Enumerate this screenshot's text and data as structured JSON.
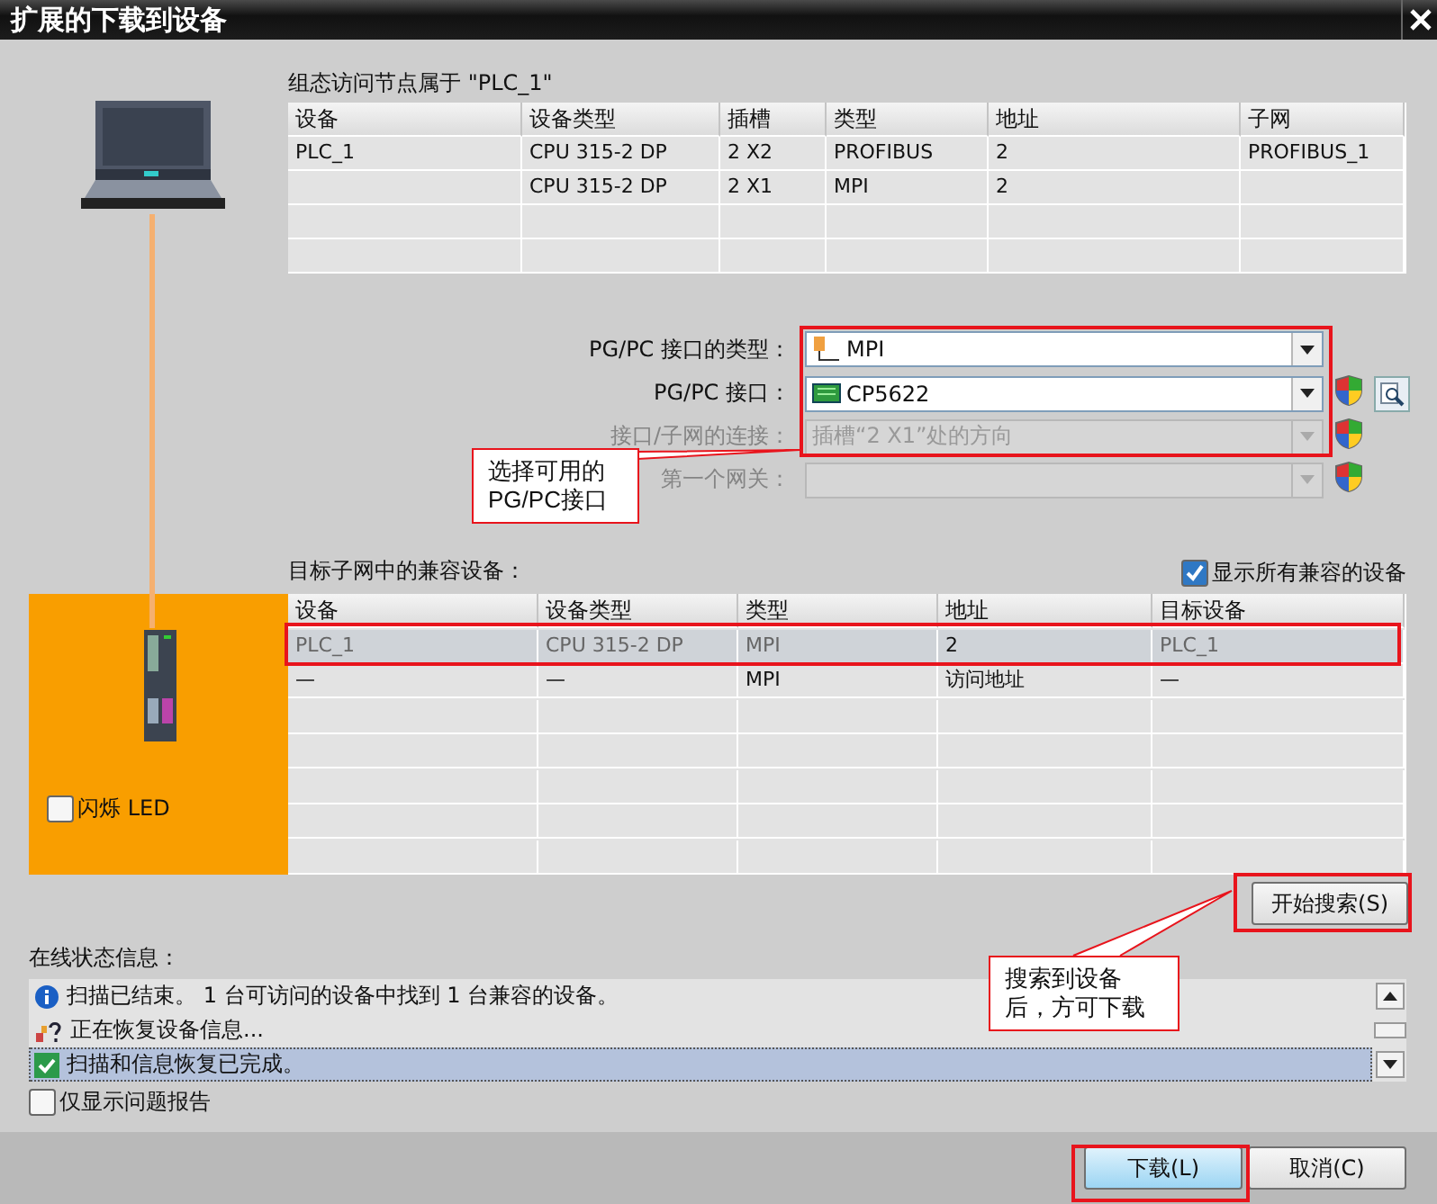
{
  "window": {
    "title": "扩展的下载到设备"
  },
  "configured_nodes": {
    "caption": "组态访问节点属于 \"PLC_1\"",
    "columns": [
      "设备",
      "设备类型",
      "插槽",
      "类型",
      "地址",
      "子网"
    ],
    "rows": [
      [
        "PLC_1",
        "CPU 315-2 DP",
        "2 X2",
        "PROFIBUS",
        "2",
        "PROFIBUS_1"
      ],
      [
        null,
        "CPU 315-2 DP",
        "2 X1",
        "MPI",
        "2",
        null
      ]
    ]
  },
  "interface_fields": [
    {
      "label": "PG/PC 接口的类型：",
      "value": "MPI",
      "kind": "network",
      "disabled": false,
      "shield": false,
      "search": false
    },
    {
      "label": "PG/PC 接口：",
      "value": "CP5622",
      "kind": "card",
      "disabled": false,
      "shield": true,
      "search": true
    },
    {
      "label": "接口/子网的连接：",
      "value": "插槽“2 X1”处的方向",
      "kind": "plain",
      "disabled": true,
      "shield": true,
      "search": false
    },
    {
      "label": "第一个网关：",
      "kind": "plain",
      "disabled": true,
      "shield": true,
      "search": false
    }
  ],
  "compatible_devices": {
    "caption": "目标子网中的兼容设备：",
    "show_all": {
      "label": "显示所有兼容的设备",
      "checked": true
    },
    "flash_led": {
      "label": "闪烁 LED",
      "checked": false
    },
    "columns": [
      "设备",
      "设备类型",
      "类型",
      "地址",
      "目标设备"
    ],
    "rows": [
      {
        "cells": [
          "PLC_1",
          "CPU 315-2 DP",
          "MPI",
          "2",
          "PLC_1"
        ],
        "selected": true
      },
      {
        "cells": [
          "—",
          "—",
          "MPI",
          "访问地址",
          "—"
        ],
        "selected": false
      }
    ]
  },
  "search_button": "开始搜索(S)",
  "online_status": {
    "caption": "在线状态信息：",
    "messages": [
      {
        "kind": "info",
        "text": "扫描已结束。 1 台可访问的设备中找到 1 台兼容的设备。",
        "selected": false
      },
      {
        "kind": "progress",
        "text": "正在恢复设备信息...",
        "selected": false
      },
      {
        "kind": "done",
        "text": "扫描和信息恢复已完成。",
        "selected": true
      }
    ],
    "problems_only": {
      "label": "仅显示问题报告",
      "checked": false
    }
  },
  "buttons": [
    {
      "label": "下载(L)",
      "kind": "primary"
    },
    {
      "label": "取消(C)",
      "kind": "normal"
    }
  ],
  "annotations": [
    {
      "lines": [
        "选择可用的",
        "PG/PC接口"
      ]
    },
    {
      "lines": [
        "搜索到设备",
        "后，方可下载"
      ]
    }
  ]
}
